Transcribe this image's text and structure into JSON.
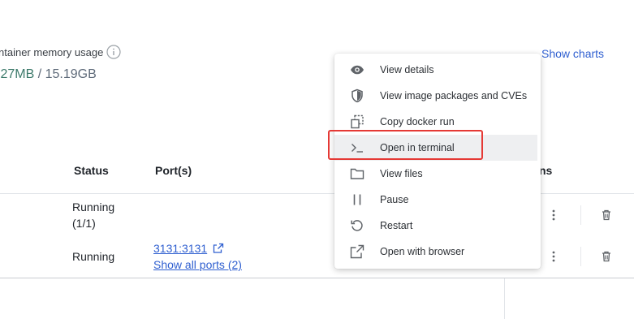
{
  "summary": {
    "memory_label": "ntainer memory usage",
    "memory_used": ".27MB",
    "memory_separator": " / ",
    "memory_total": "15.19GB",
    "show_charts_label": "Show charts"
  },
  "table": {
    "columns": {
      "status": "Status",
      "ports": "Port(s)",
      "actions": "ns"
    },
    "rows": [
      {
        "status_line1": "Running",
        "status_line2": "(1/1)"
      },
      {
        "status": "Running",
        "port": "3131:3131",
        "show_all_ports": "Show all ports (2)"
      }
    ]
  },
  "context_menu": {
    "items": [
      {
        "label": "View details",
        "icon": "eye-icon"
      },
      {
        "label": "View image packages and CVEs",
        "icon": "shield-icon"
      },
      {
        "label": "Copy docker run",
        "icon": "copy-icon"
      },
      {
        "label": "Open in terminal",
        "icon": "terminal-icon",
        "highlighted": true
      },
      {
        "label": "View files",
        "icon": "folder-icon"
      },
      {
        "label": "Pause",
        "icon": "pause-icon"
      },
      {
        "label": "Restart",
        "icon": "restart-icon"
      },
      {
        "label": "Open with browser",
        "icon": "external-link-icon"
      }
    ]
  },
  "colors": {
    "link": "#2f5fd0",
    "memory_used": "#3d7a6b",
    "annotation_box": "#e53935",
    "menu_highlight": "#eeeff1"
  }
}
